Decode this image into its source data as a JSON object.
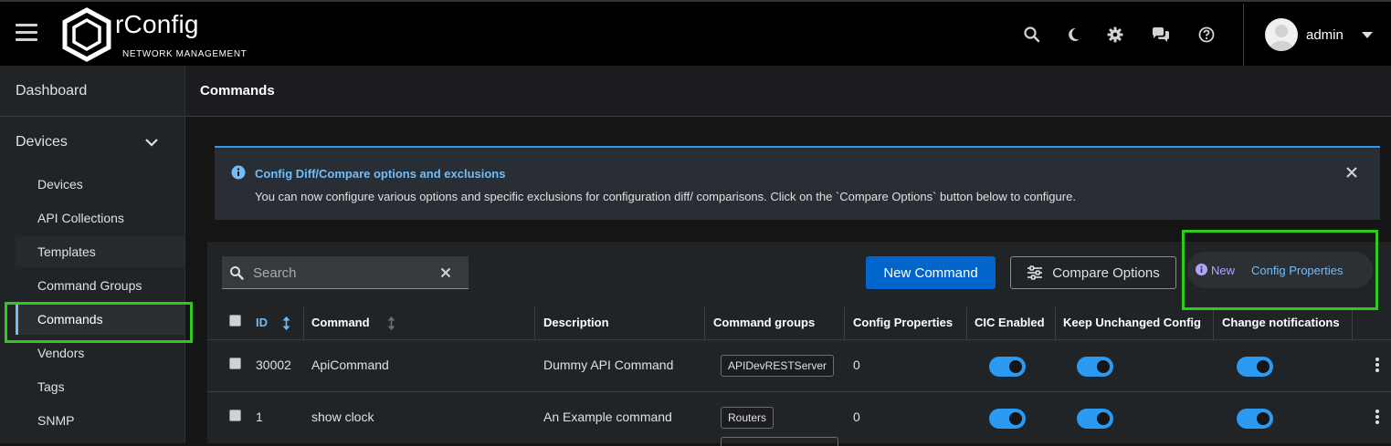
{
  "brand": {
    "name": "rConfig",
    "subtitle": "NETWORK MANAGEMENT"
  },
  "toolbar_icons": [
    "search-icon",
    "moon-icon",
    "gear-icon",
    "chat-icon",
    "help-icon"
  ],
  "user": {
    "name": "admin"
  },
  "sidebar": {
    "dashboard": "Dashboard",
    "group": "Devices",
    "items": [
      {
        "label": "Devices"
      },
      {
        "label": "API Collections"
      },
      {
        "label": "Templates"
      },
      {
        "label": "Command Groups"
      },
      {
        "label": "Commands",
        "active": true
      },
      {
        "label": "Vendors"
      },
      {
        "label": "Tags"
      },
      {
        "label": "SNMP"
      }
    ]
  },
  "page": {
    "title": "Commands"
  },
  "alert": {
    "title": "Config Diff/Compare options and exclusions",
    "description": "You can now configure various options and specific exclusions for configuration diff/ comparisons. Click on the `Compare Options` button below to configure."
  },
  "toolbar": {
    "search_placeholder": "Search",
    "new_command": "New Command",
    "compare_options": "Compare Options",
    "new_badge": "New",
    "new_link": "Config Properties"
  },
  "table": {
    "columns": [
      "ID",
      "Command",
      "Description",
      "Command groups",
      "Config Properties",
      "CIC Enabled",
      "Keep Unchanged Config",
      "Change notifications"
    ],
    "rows": [
      {
        "id": "30002",
        "command": "ApiCommand",
        "description": "Dummy API Command",
        "groups": [
          "APIDevRESTServer"
        ],
        "config_properties": "0",
        "cic": true,
        "keep": true,
        "notify": true
      },
      {
        "id": "1",
        "command": "show clock",
        "description": "An Example command",
        "groups": [
          "Routers"
        ],
        "config_properties": "0",
        "cic": true,
        "keep": true,
        "notify": true
      }
    ]
  },
  "colors": {
    "primary": "#0066cc",
    "accent": "#73bcf7",
    "highlight": "#2ecc1a",
    "toggle_on": "#2b9af3"
  }
}
